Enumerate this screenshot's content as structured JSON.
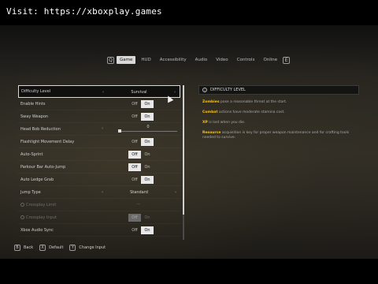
{
  "watermark": "Visit: https://xboxplay.games",
  "tabs": {
    "prev_key": "Q",
    "next_key": "E",
    "items": [
      "Game",
      "HUD",
      "Accessibility",
      "Audio",
      "Video",
      "Controls",
      "Online"
    ],
    "active": "Game"
  },
  "settings": [
    {
      "label": "Difficulty Level",
      "type": "selector",
      "value": "Survival",
      "left_arrow": "‹",
      "right_arrow": "›",
      "selected": true
    },
    {
      "label": "Enable Hints",
      "type": "toggle",
      "off": "Off",
      "on": "On",
      "value": "On"
    },
    {
      "label": "Sway Weapon",
      "type": "toggle",
      "off": "Off",
      "on": "On",
      "value": "On"
    },
    {
      "label": "Head Bob Reduction",
      "type": "slider",
      "value": "0",
      "left_arrow": "‹"
    },
    {
      "label": "Flashlight Movement Delay",
      "type": "toggle",
      "off": "Off",
      "on": "On",
      "value": "On"
    },
    {
      "label": "Auto-Sprint",
      "type": "toggle",
      "off": "Off",
      "on": "On",
      "value": "Off"
    },
    {
      "label": "Parkour Bar Auto-Jump",
      "type": "toggle",
      "off": "Off",
      "on": "On",
      "value": "Off"
    },
    {
      "label": "Auto Ledge Grab",
      "type": "toggle",
      "off": "Off",
      "on": "On",
      "value": "On"
    },
    {
      "label": "Jump Type",
      "type": "selector",
      "value": "Standard",
      "left_arrow": "‹",
      "right_arrow": "›"
    },
    {
      "label": "Crossplay Limit",
      "type": "locked",
      "value": "—",
      "disabled": true
    },
    {
      "label": "Crossplay Input",
      "type": "toggle",
      "off": "Off",
      "on": "On",
      "value": "Off",
      "disabled": true
    },
    {
      "label": "Xbox Audio Sync",
      "type": "toggle",
      "off": "Off",
      "on": "On",
      "value": "On"
    }
  ],
  "info": {
    "title": "DIFFICULTY LEVEL",
    "icon": "info-icon",
    "lines": [
      {
        "term": "Zombies",
        "text": " pose a reasonable threat at the start."
      },
      {
        "term": "Combat",
        "text": " actions have moderate stamina cost."
      },
      {
        "term": "XP",
        "text": " is lost when you die."
      },
      {
        "term": "Resource",
        "text": " acquisition is key for proper weapon maintenance and for crafting tools needed to survive."
      }
    ]
  },
  "hints": [
    {
      "key": "B",
      "label": "Back"
    },
    {
      "key": "X",
      "label": "Default"
    },
    {
      "key": "Y",
      "label": "Change Input"
    }
  ],
  "colors": {
    "accent": "#ffc300",
    "selected_border": "#d8d8d8",
    "toggle_on": "#e8e8e8"
  }
}
